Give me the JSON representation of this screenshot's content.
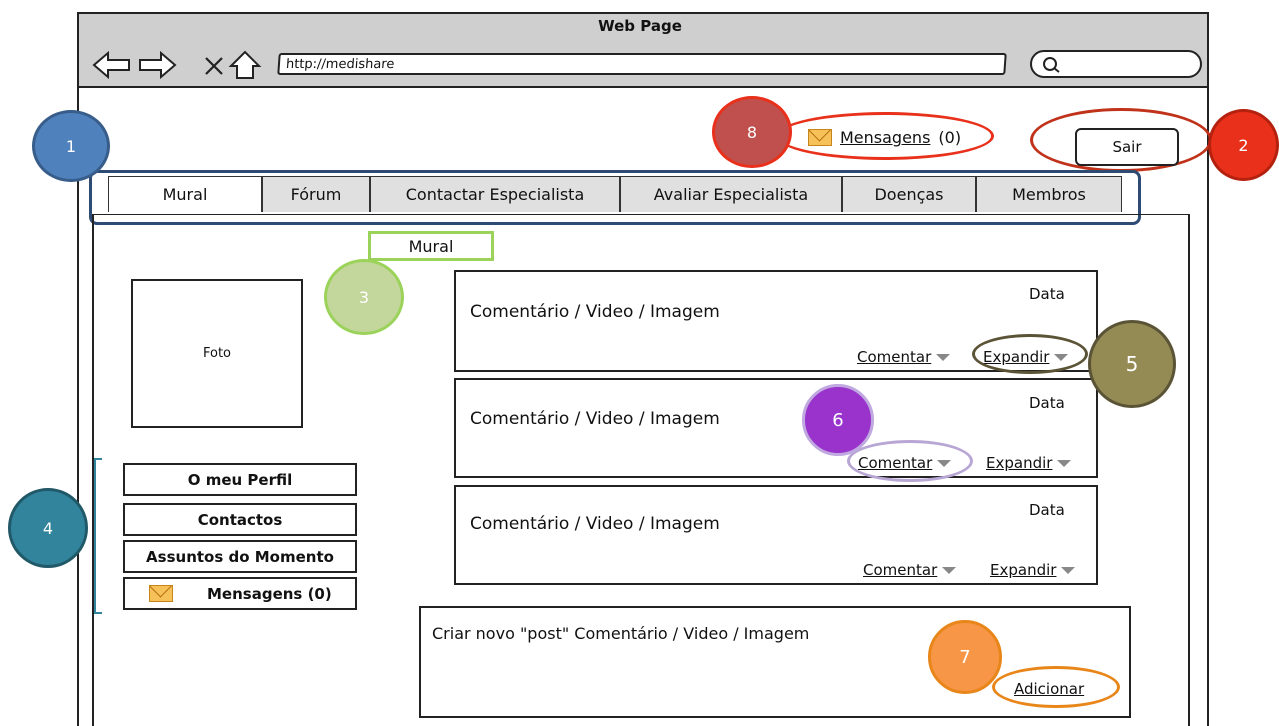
{
  "browser": {
    "page_title": "Web Page",
    "url": "http://medishare"
  },
  "header": {
    "messages_link": "Mensagens",
    "messages_count": "(0)",
    "logout_label": "Sair"
  },
  "tabs": [
    {
      "label": "Mural",
      "active": true
    },
    {
      "label": "Fórum"
    },
    {
      "label": "Contactar Especialista"
    },
    {
      "label": "Avaliar Especialista"
    },
    {
      "label": "Doenças"
    },
    {
      "label": "Membros"
    }
  ],
  "mural": {
    "section_label": "Mural",
    "photo_label": "Foto"
  },
  "sidebar": {
    "items": [
      {
        "label": "O meu Perfil"
      },
      {
        "label": "Contactos"
      },
      {
        "label": "Assuntos do Momento"
      },
      {
        "label": "Mensagens (0)"
      }
    ]
  },
  "posts": [
    {
      "text": "Comentário / Video / Imagem",
      "date": "Data",
      "comment_label": "Comentar",
      "expand_label": "Expandir"
    },
    {
      "text": "Comentário / Video / Imagem",
      "date": "Data",
      "comment_label": "Comentar",
      "expand_label": "Expandir"
    },
    {
      "text": "Comentário / Video / Imagem",
      "date": "Data",
      "comment_label": "Comentar",
      "expand_label": "Expandir"
    }
  ],
  "new_post": {
    "text": "Criar novo \"post\" Comentário / Video / Imagem",
    "add_label": "Adicionar"
  },
  "callouts": [
    {
      "number": "1",
      "color": "#4f81bd"
    },
    {
      "number": "2",
      "color": "#e8301a"
    },
    {
      "number": "3",
      "color": "#c3d69b"
    },
    {
      "number": "4",
      "color": "#31849b"
    },
    {
      "number": "5",
      "color": "#948a54"
    },
    {
      "number": "6",
      "color": "#9933cc"
    },
    {
      "number": "7",
      "color": "#f79646"
    },
    {
      "number": "8",
      "color": "#c0504d"
    }
  ]
}
